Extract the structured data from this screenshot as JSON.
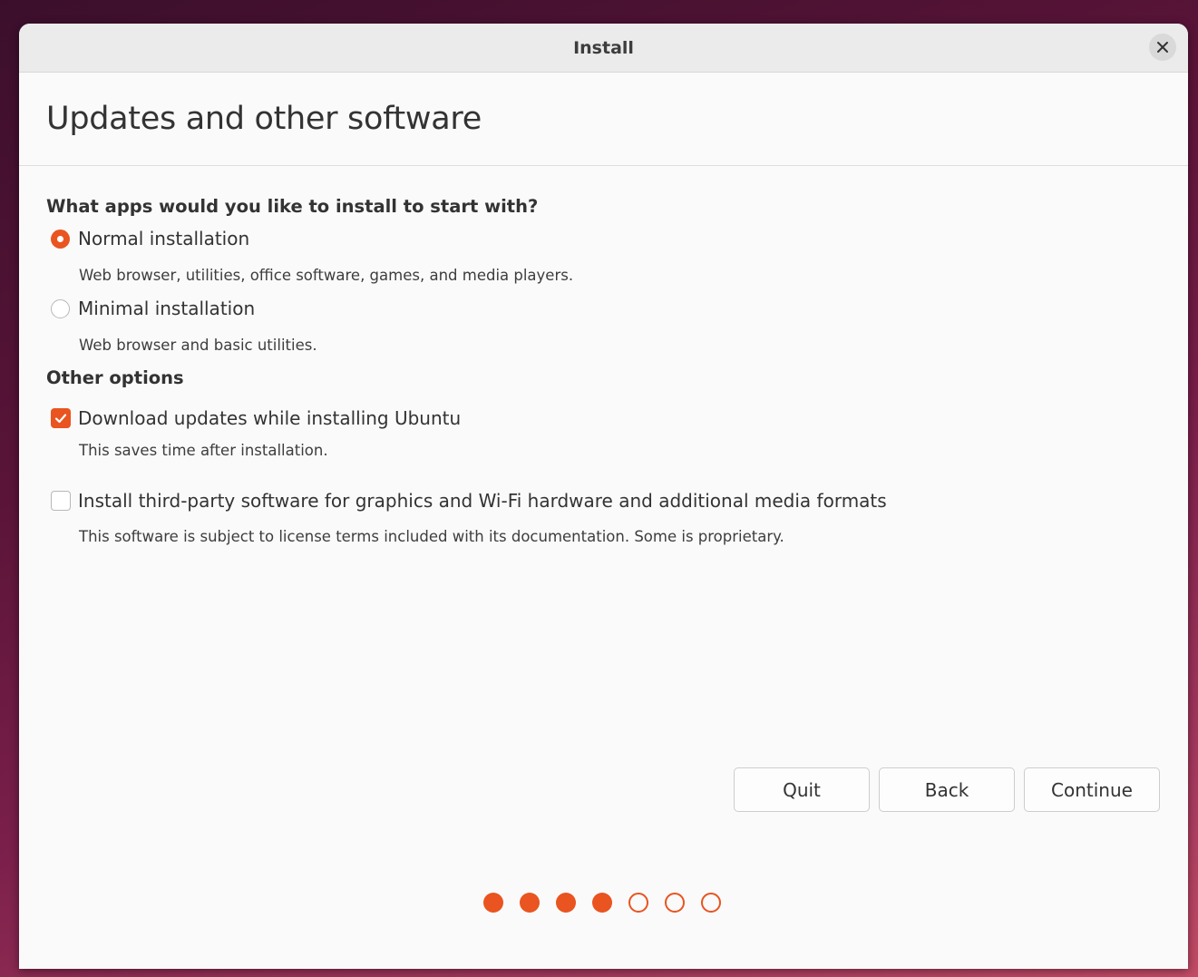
{
  "window": {
    "title": "Install",
    "close_icon": "close-icon"
  },
  "page": {
    "title": "Updates and other software"
  },
  "apps_section": {
    "heading": "What apps would you like to install to start with?",
    "options": [
      {
        "label": "Normal installation",
        "description": "Web browser, utilities, office software, games, and media players.",
        "selected": true
      },
      {
        "label": "Minimal installation",
        "description": "Web browser and basic utilities.",
        "selected": false
      }
    ]
  },
  "other_section": {
    "heading": "Other options",
    "options": [
      {
        "label": "Download updates while installing Ubuntu",
        "description": "This saves time after installation.",
        "checked": true
      },
      {
        "label": "Install third-party software for graphics and Wi-Fi hardware and additional media formats",
        "description": "This software is subject to license terms included with its documentation. Some is proprietary.",
        "checked": false
      }
    ]
  },
  "buttons": {
    "quit": "Quit",
    "back": "Back",
    "continue": "Continue"
  },
  "progress": {
    "completed_steps": 4,
    "total_steps": 7
  },
  "colors": {
    "accent": "#e95420",
    "window_bg": "#fafafa",
    "titlebar_bg": "#ebebeb",
    "text": "#333333"
  }
}
